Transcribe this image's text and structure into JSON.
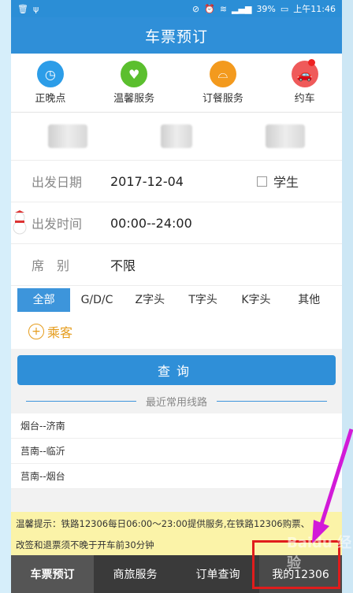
{
  "status": {
    "battery": "39%",
    "time": "上午11:46"
  },
  "appbar": {
    "title": "车票预订"
  },
  "quick": [
    {
      "label": "正晚点",
      "icon": "clock-icon",
      "color": "#2c9de8"
    },
    {
      "label": "温馨服务",
      "icon": "heart-hand-icon",
      "color": "#5bbf2e"
    },
    {
      "label": "订餐服务",
      "icon": "food-dome-icon",
      "color": "#f39a1e"
    },
    {
      "label": "约车",
      "icon": "car-icon",
      "color": "#ef5a5a"
    }
  ],
  "form": {
    "date_label": "出发日期",
    "date_value": "2017-12-04",
    "student_label": "学生",
    "time_label": "出发时间",
    "time_value": "00:00--24:00",
    "seat_label": "席　别",
    "seat_value": "不限"
  },
  "filters": [
    "全部",
    "G/D/C",
    "Z字头",
    "T字头",
    "K字头",
    "其他"
  ],
  "passenger": {
    "label": "乘客"
  },
  "query_button": "查询",
  "recent": {
    "title": "最近常用线路",
    "routes": [
      "烟台--济南",
      "莒南--临沂",
      "莒南--烟台"
    ]
  },
  "tip": {
    "line1": "温馨提示：铁路12306每日06:00～23:00提供服务,在铁路12306购票、",
    "line2": "改签和退票须不晚于开车前30分钟"
  },
  "tabs": [
    "车票预订",
    "商旅服务",
    "订单查询",
    "我的12306"
  ],
  "watermark": "Baidu 经验",
  "colors": {
    "primary": "#2f8fd8",
    "highlight": "#e01c1c",
    "arrow": "#d21ad8"
  }
}
